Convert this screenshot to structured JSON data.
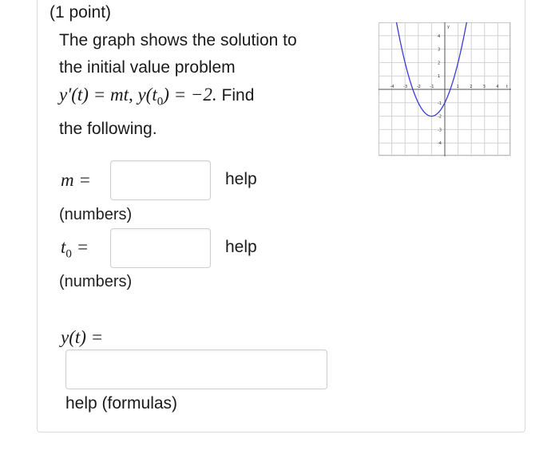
{
  "problem": {
    "points": "(1 point)",
    "line1": "The graph shows the solution to",
    "line2": "the initial value problem",
    "eq_yprime": "y′(t) = mt, y(t",
    "eq_sub": "0",
    "eq_rest": ") = −2.",
    "find": "Find",
    "line4": "the following."
  },
  "fields": {
    "m_label": "m =",
    "t0_label_t": "t",
    "t0_label_sub": "0",
    "t0_label_eq": " =",
    "yt_label": "y(t) =",
    "help": "help",
    "numbers_hint": "(numbers)",
    "formulas_help": "help (formulas)",
    "m_value": "",
    "t0_value": "",
    "yt_value": ""
  },
  "graph": {
    "x_ticks": [
      "-4",
      "-3",
      "-2",
      "-1",
      "1",
      "2",
      "3",
      "4"
    ],
    "y_ticks": [
      "4",
      "3",
      "2",
      "1",
      "-1",
      "-2",
      "-3",
      "-4"
    ],
    "y_axis_label": "y",
    "x_axis_label": "t",
    "curve_color": "#3b3bd6"
  }
}
